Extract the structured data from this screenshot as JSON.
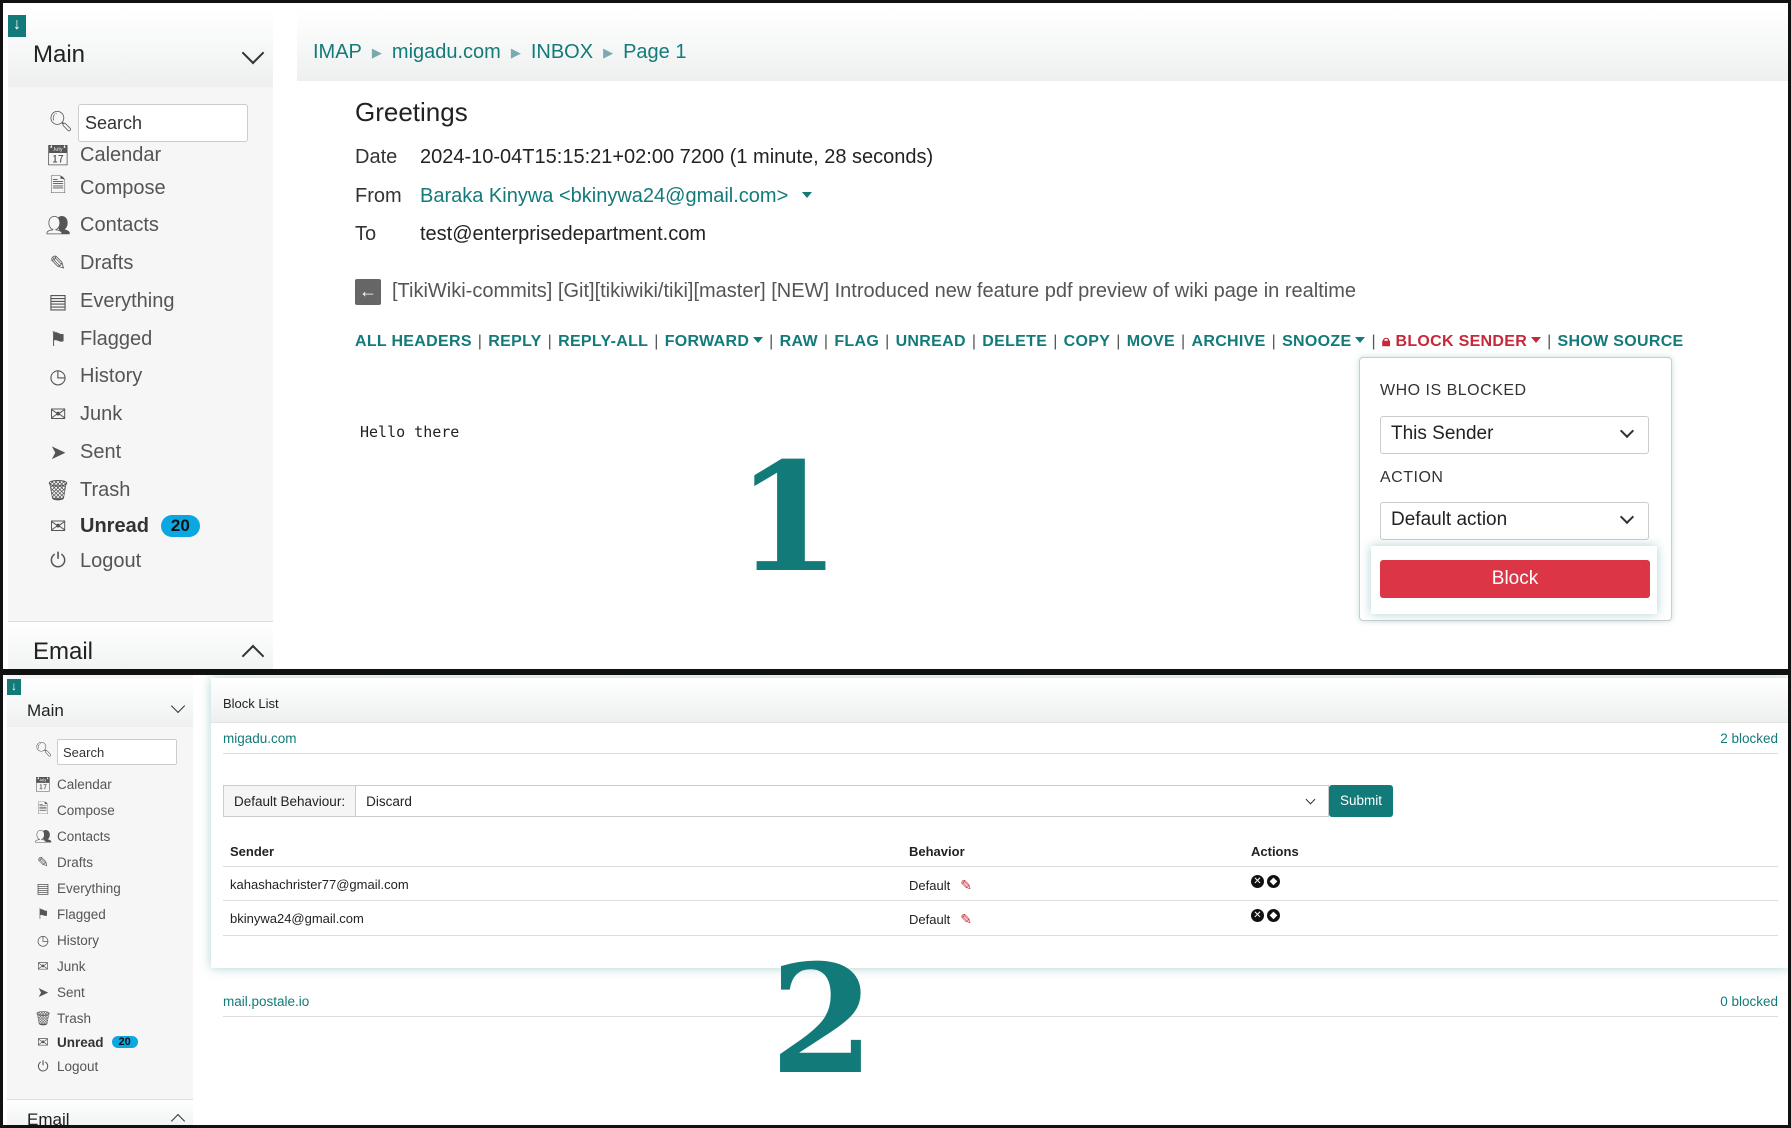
{
  "panel1": {
    "sidebar": {
      "main_title": "Main",
      "search_placeholder": "Search",
      "items": [
        {
          "label": "Calendar",
          "icon": "calendar-icon"
        },
        {
          "label": "Compose",
          "icon": "compose-icon"
        },
        {
          "label": "Contacts",
          "icon": "contacts-icon"
        },
        {
          "label": "Drafts",
          "icon": "drafts-icon"
        },
        {
          "label": "Everything",
          "icon": "everything-icon"
        },
        {
          "label": "Flagged",
          "icon": "flag-icon"
        },
        {
          "label": "History",
          "icon": "history-icon"
        },
        {
          "label": "Junk",
          "icon": "junk-icon"
        },
        {
          "label": "Sent",
          "icon": "sent-icon"
        },
        {
          "label": "Trash",
          "icon": "trash-icon"
        },
        {
          "label": "Unread",
          "icon": "unread-icon",
          "badge": "20"
        },
        {
          "label": "Logout",
          "icon": "logout-icon"
        }
      ],
      "email_title": "Email"
    },
    "breadcrumb": [
      "IMAP",
      "migadu.com",
      "INBOX",
      "Page 1"
    ],
    "message": {
      "subject": "Greetings",
      "date_label": "Date",
      "date_value": "2024-10-04T15:15:21+02:00 7200 (1 minute, 28 seconds)",
      "from_label": "From",
      "from_value": "Baraka Kinywa <bkinywa24@gmail.com>",
      "to_label": "To",
      "to_value": "test@enterprisedepartment.com",
      "thread": "[TikiWiki-commits] [Git][tikiwiki/tiki][master] [NEW] Introduced new feature pdf preview of wiki page in realtime",
      "body": "Hello there"
    },
    "actions": {
      "all_headers": "ALL HEADERS",
      "reply": "REPLY",
      "reply_all": "REPLY-ALL",
      "forward": "FORWARD",
      "raw": "RAW",
      "flag": "FLAG",
      "unread": "UNREAD",
      "delete": "DELETE",
      "copy": "COPY",
      "move": "MOVE",
      "archive": "ARCHIVE",
      "snooze": "SNOOZE",
      "block_sender": "BLOCK SENDER",
      "show_source": "SHOW SOURCE"
    },
    "block_popup": {
      "who_label": "WHO IS BLOCKED",
      "who_value": "This Sender",
      "action_label": "ACTION",
      "action_value": "Default action",
      "block_button": "Block"
    },
    "marker": "1"
  },
  "panel2": {
    "sidebar": {
      "main_title": "Main",
      "search_placeholder": "Search",
      "items": [
        {
          "label": "Calendar"
        },
        {
          "label": "Compose"
        },
        {
          "label": "Contacts"
        },
        {
          "label": "Drafts"
        },
        {
          "label": "Everything"
        },
        {
          "label": "Flagged"
        },
        {
          "label": "History"
        },
        {
          "label": "Junk"
        },
        {
          "label": "Sent"
        },
        {
          "label": "Trash"
        },
        {
          "label": "Unread",
          "badge": "20"
        },
        {
          "label": "Logout"
        }
      ],
      "email_title": "Email"
    },
    "block_list": {
      "title": "Block List",
      "domains": [
        {
          "name": "migadu.com",
          "count": "2 blocked"
        },
        {
          "name": "mail.postale.io",
          "count": "0 blocked"
        }
      ],
      "default_behaviour_label": "Default Behaviour:",
      "default_behaviour_value": "Discard",
      "submit_label": "Submit",
      "columns": [
        "Sender",
        "Behavior",
        "Actions"
      ],
      "rows": [
        {
          "sender": "kahashachrister77@gmail.com",
          "behavior": "Default"
        },
        {
          "sender": "bkinywa24@gmail.com",
          "behavior": "Default"
        }
      ]
    },
    "marker": "2"
  },
  "colors": {
    "accent": "#137a7a",
    "danger": "#dc3545",
    "badge": "#0aa7e0"
  }
}
